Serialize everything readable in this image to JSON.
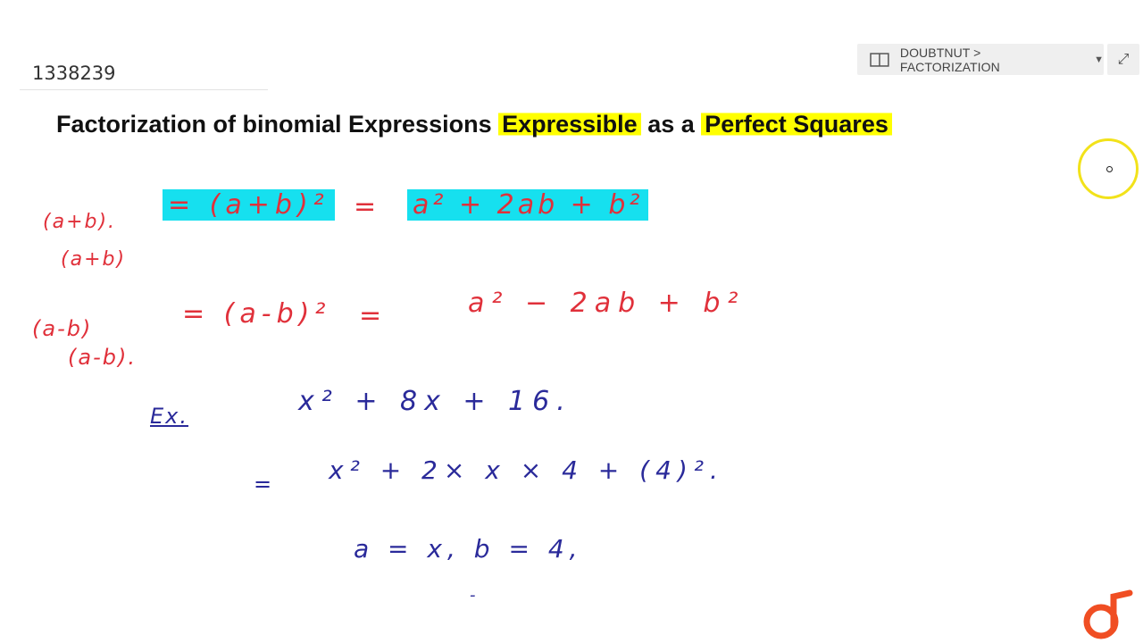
{
  "video_id": "1338239",
  "breadcrumb": {
    "text": "DOUBTNUT > FACTORIZATION",
    "icon": "book-icon",
    "dropdown_icon": "caret-down-icon"
  },
  "expand_icon": "expand-icon",
  "title": {
    "part1": "Factorization of binomial Expressions ",
    "part2": "Expressible",
    "part3": " as a ",
    "part4": "Perfect Squares"
  },
  "board": {
    "line1_left_a": "(a+b).",
    "line1_left_b": "(a+b)",
    "line1_eq": "= (a+b)²",
    "line1_eq2": "=",
    "line1_rhs": "a² + 2ab + b²",
    "line2_left_a": "(a-b)",
    "line2_left_b": "(a-b).",
    "line2_eq": "= (a-b)²",
    "line2_eq2": "=",
    "line2_rhs": "a²  −  2ab  + b²",
    "ex_label": "Ex.",
    "ex_expr": "x² +  8x + 16.",
    "step1_eq": "=",
    "step1_expr": "x² + 2× x × 4 + (4)².",
    "step2": "a = x,   b = 4,",
    "dash": "-"
  },
  "colors": {
    "red_ink": "#e0303a",
    "blue_ink": "#2a2a9a",
    "yellow_highlight": "#ffff00",
    "cyan_highlight": "#16e0ef",
    "brand_orange": "#f04e23"
  },
  "logo": "doubtnut-logo-icon"
}
